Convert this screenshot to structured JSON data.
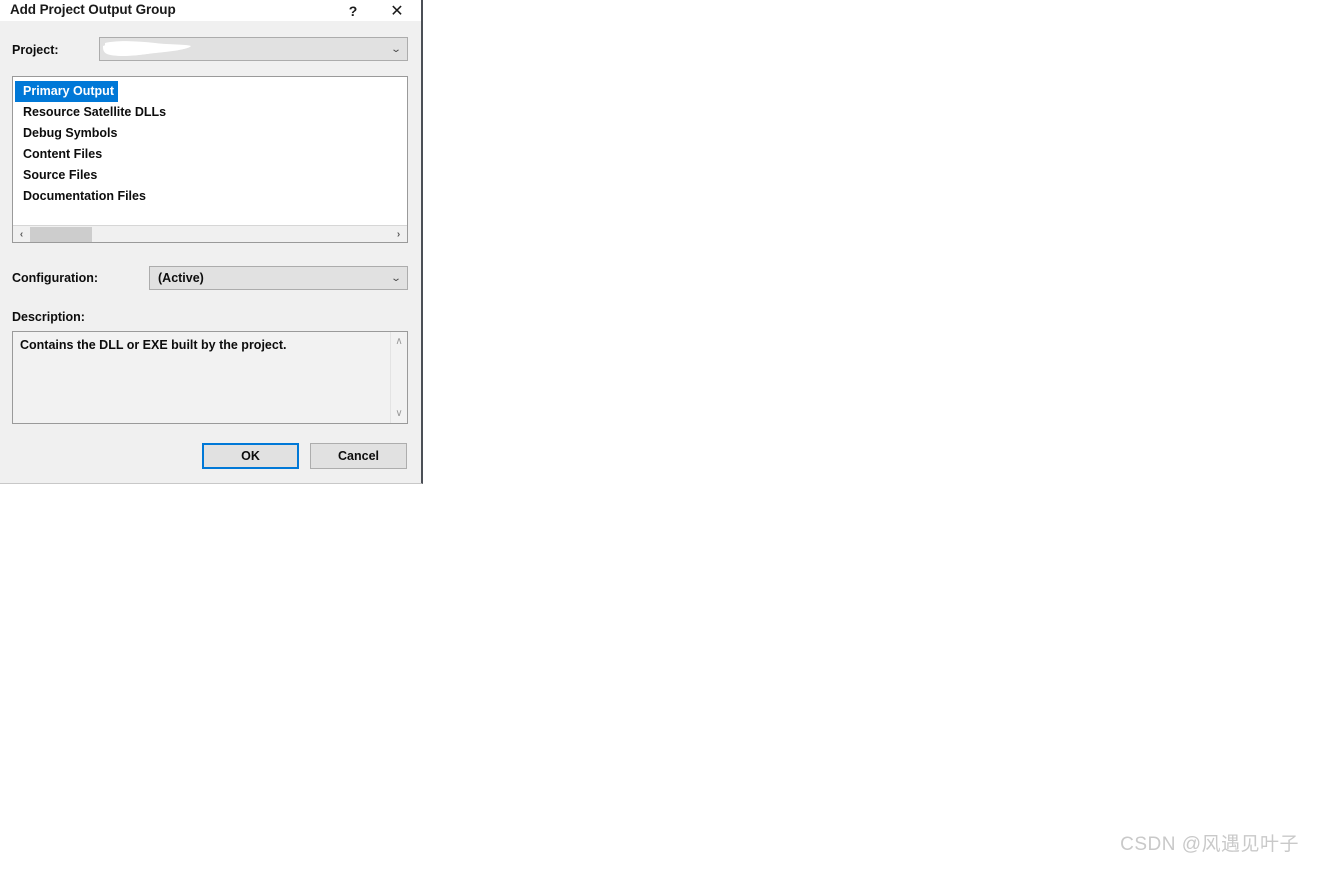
{
  "dialog": {
    "title": "Add Project Output Group",
    "help_icon": "question-mark-icon",
    "close_icon": "close-icon",
    "accent_color": "#0078d7",
    "body_background": "#f0f0f0"
  },
  "project": {
    "label": "Project:",
    "value": "",
    "redacted": true,
    "chevron": "⌄"
  },
  "output_groups": {
    "items": [
      {
        "label": "Primary Output",
        "selected": true
      },
      {
        "label": "Resource Satellite DLLs",
        "selected": false
      },
      {
        "label": "Debug Symbols",
        "selected": false
      },
      {
        "label": "Content Files",
        "selected": false
      },
      {
        "label": "Source Files",
        "selected": false
      },
      {
        "label": "Documentation Files",
        "selected": false
      }
    ],
    "selection_color": "#0078d7",
    "scrollbar": {
      "left_arrow": "‹",
      "right_arrow": "›"
    }
  },
  "configuration": {
    "label": "Configuration:",
    "value": "(Active)",
    "chevron": "⌄"
  },
  "description": {
    "label": "Description:",
    "text": "Contains the DLL or EXE built by the project.",
    "scrollbar": {
      "up_arrow": "∧",
      "down_arrow": "∨"
    }
  },
  "buttons": {
    "ok": "OK",
    "cancel": "Cancel"
  },
  "watermark": {
    "text": "CSDN @风遇见叶子"
  }
}
